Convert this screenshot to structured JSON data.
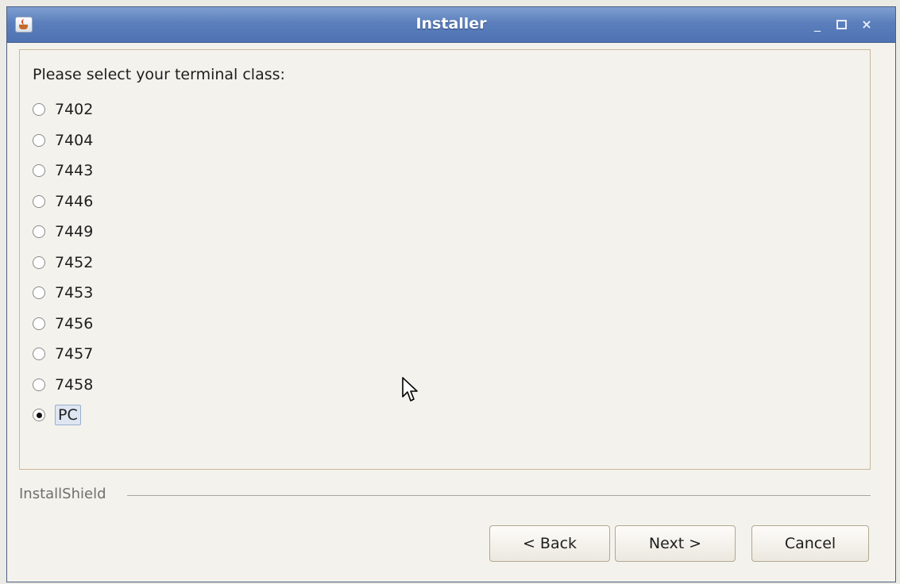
{
  "window": {
    "title": "Installer",
    "controls": [
      "minimize-icon",
      "maximize-icon",
      "close-icon"
    ]
  },
  "panel": {
    "prompt": "Please select your terminal class:",
    "options": [
      {
        "label": "7402",
        "selected": false
      },
      {
        "label": "7404",
        "selected": false
      },
      {
        "label": "7443",
        "selected": false
      },
      {
        "label": "7446",
        "selected": false
      },
      {
        "label": "7449",
        "selected": false
      },
      {
        "label": "7452",
        "selected": false
      },
      {
        "label": "7453",
        "selected": false
      },
      {
        "label": "7456",
        "selected": false
      },
      {
        "label": "7457",
        "selected": false
      },
      {
        "label": "7458",
        "selected": false
      },
      {
        "label": "PC",
        "selected": true
      }
    ]
  },
  "footer": {
    "brand": "InstallShield",
    "buttons": {
      "back": "< Back",
      "next": "Next >",
      "cancel": "Cancel"
    }
  },
  "colors": {
    "titlebar": "#5b7fbc",
    "background": "#f4f2ec",
    "panel_border": "#c9b99a"
  }
}
